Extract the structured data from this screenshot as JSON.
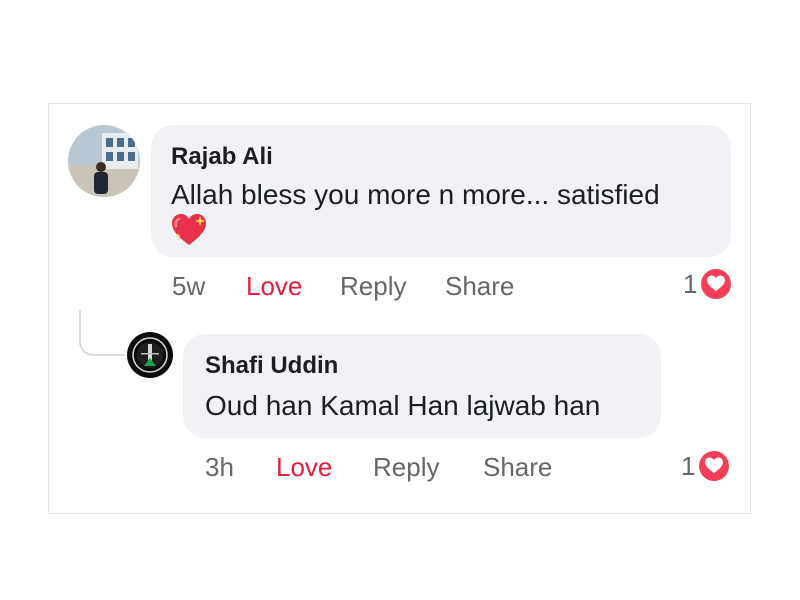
{
  "comments": [
    {
      "author": "Rajab Ali",
      "text": "Allah bless you more n more... satisfied",
      "emoji": "sparkling-heart",
      "time": "5w",
      "love_label": "Love",
      "reply_label": "Reply",
      "share_label": "Share",
      "reaction_count": "1",
      "reaction_icon": "heart-icon"
    },
    {
      "author": "Shafi Uddin",
      "text": "Oud han Kamal Han lajwab han",
      "time": "3h",
      "love_label": "Love",
      "reply_label": "Reply",
      "share_label": "Share",
      "reaction_count": "1",
      "reaction_icon": "heart-icon"
    }
  ],
  "colors": {
    "bubble": "#f0f2f5",
    "love": "#e41e3f",
    "meta": "#65676b",
    "heart": "#f33e58"
  }
}
